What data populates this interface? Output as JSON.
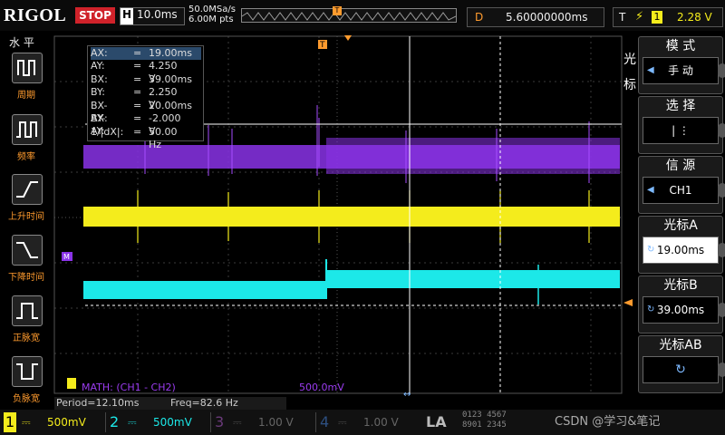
{
  "topbar": {
    "logo": "RIGOL",
    "run_state": "STOP",
    "horizontal_label": "H",
    "timebase": "10.0ms",
    "sample_rate": "50.0MSa/s",
    "mem_depth": "6.00M pts",
    "trigger_marker": "T",
    "delay_label": "D",
    "delay_value": "5.60000000ms",
    "trig_label": "T",
    "trig_channel": "1",
    "trig_level": "2.28 V"
  },
  "left_panel": {
    "title": "水 平",
    "items": [
      {
        "label": "周期",
        "icon": "period-icon"
      },
      {
        "label": "频率",
        "icon": "frequency-icon"
      },
      {
        "label": "上升时间",
        "icon": "rise-time-icon"
      },
      {
        "label": "下降时间",
        "icon": "fall-time-icon"
      },
      {
        "label": "正脉宽",
        "icon": "positive-width-icon"
      },
      {
        "label": "负脉宽",
        "icon": "negative-width-icon"
      }
    ]
  },
  "right_panel": {
    "title_top": "光",
    "title_bottom": "标",
    "menus": [
      {
        "title": "模 式",
        "value": "手 动"
      },
      {
        "title": "选 择",
        "value": "| ⋮"
      },
      {
        "title": "信 源",
        "value": "CH1"
      },
      {
        "title": "光标A",
        "value": "19.00ms"
      },
      {
        "title": "光标B",
        "value": "39.00ms"
      },
      {
        "title": "光标AB",
        "value": ""
      }
    ]
  },
  "measurements": [
    {
      "key": "AX:",
      "eq": "=",
      "val": "19.00ms"
    },
    {
      "key": "AY:",
      "eq": "=",
      "val": "4.250 V"
    },
    {
      "key": "BX:",
      "eq": "=",
      "val": "39.00ms"
    },
    {
      "key": "BY:",
      "eq": "=",
      "val": "2.250 V"
    },
    {
      "key": "BX-AX:",
      "eq": "=",
      "val": "20.00ms"
    },
    {
      "key": "BY-AY:",
      "eq": "=",
      "val": "-2.000 V"
    },
    {
      "key": "1/|dX|:",
      "eq": "=",
      "val": "50.00 Hz"
    }
  ],
  "math": {
    "label": "MATH: (CH1 - CH2)",
    "scale": "500.0mV",
    "marker": "M"
  },
  "info": {
    "period": "Period=12.10ms",
    "freq": "Freq=82.6 Hz"
  },
  "channels": [
    {
      "num": "1",
      "scale": "500mV",
      "color": "#f4ec1c",
      "active": true
    },
    {
      "num": "2",
      "scale": "500mV",
      "color": "#1ce8e8",
      "active": true
    },
    {
      "num": "3",
      "scale": "1.00 V",
      "color": "#b34ad8",
      "active": false
    },
    {
      "num": "4",
      "scale": "1.00 V",
      "color": "#3d7fe0",
      "active": false
    }
  ],
  "la": {
    "label": "LA",
    "grid1": "0123 4567",
    "grid2": "8901 2345"
  },
  "watermark": "CSDN @学习&笔记",
  "colors": {
    "ch1": "#f4ec1c",
    "ch2": "#1ce8e8",
    "math": "#9b3cf0",
    "accent": "#ff9b2e",
    "stop": "#d0222a"
  }
}
